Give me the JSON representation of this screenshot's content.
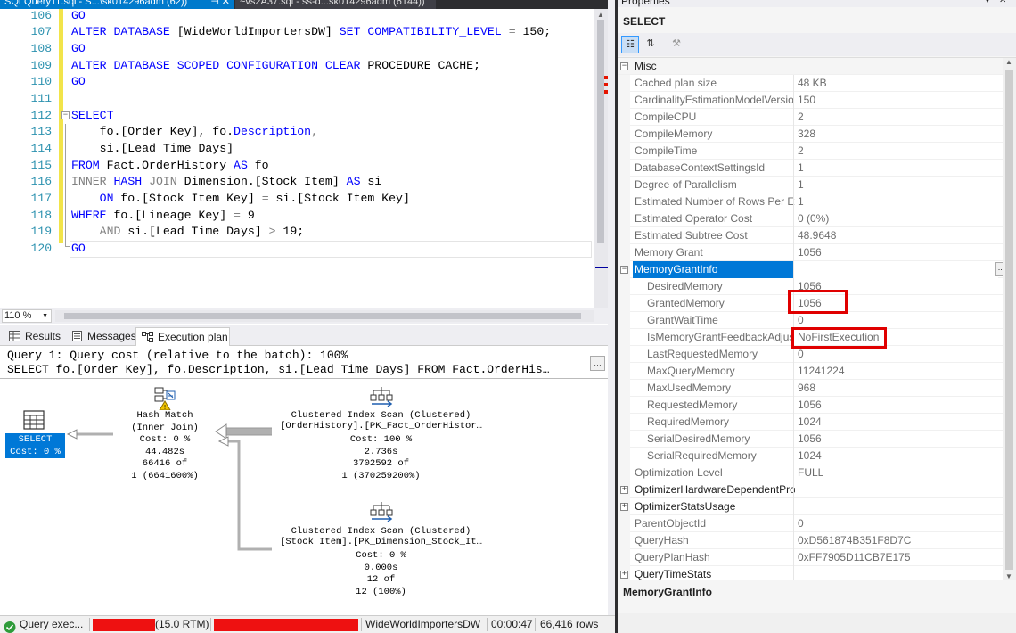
{
  "doc_tabs": {
    "active_label": "SQLQuery11.sql - S...\\sk014296adm (62))",
    "inactive_label": "~vs2A37.sql - ss-d...sk014296adm (6144))",
    "pin_glyph": "⊣",
    "close_glyph": "✕"
  },
  "editor": {
    "line_numbers": [
      "106",
      "107",
      "108",
      "109",
      "110",
      "111",
      "112",
      "113",
      "114",
      "115",
      "116",
      "117",
      "118",
      "119",
      "120"
    ],
    "code": {
      "l106": {
        "a": "GO"
      },
      "l107": {
        "a": "ALTER DATABASE ",
        "b": "[WideWorldImportersDW]",
        "c": " SET COMPATIBILITY_LEVEL ",
        "d": "=",
        "e": " 150;"
      },
      "l108": {
        "a": "GO"
      },
      "l109": {
        "a": "ALTER DATABASE SCOPED CONFIGURATION CLEAR",
        "b": " PROCEDURE_CACHE;"
      },
      "l110": {
        "a": "GO"
      },
      "l112": {
        "a": "SELECT"
      },
      "l113": {
        "a": "    fo.[Order Key], fo.",
        "b": "Description",
        "c": ","
      },
      "l114": {
        "a": "    si.[Lead Time Days]"
      },
      "l115": {
        "a": "FROM",
        "b": " Fact.OrderHistory ",
        "c": "AS",
        "d": " fo"
      },
      "l116": {
        "a": "INNER",
        "b": " HASH ",
        "c": "JOIN",
        "d": " Dimension.[Stock Item] ",
        "e": "AS",
        "f": " si"
      },
      "l117": {
        "a": "    ",
        "b": "ON",
        "c": " fo.[Stock Item Key] ",
        "d": "=",
        "e": " si.[Stock Item Key]"
      },
      "l118": {
        "a": "WHERE",
        "b": " fo.[Lineage Key] ",
        "c": "=",
        "d": " 9"
      },
      "l119": {
        "a": "    ",
        "b": "AND",
        "c": " si.[Lead Time Days] ",
        "d": ">",
        "e": " 19;"
      },
      "l120": {
        "a": "GO"
      }
    },
    "outline_collapse_glyph": "−"
  },
  "zoom": {
    "value": "110 %",
    "dropdown_glyph": "▼"
  },
  "result_tabs": [
    {
      "label": "Results"
    },
    {
      "label": "Messages"
    },
    {
      "label": "Execution plan"
    }
  ],
  "plan": {
    "header_line1": "Query 1: Query cost (relative to the batch): 100%",
    "header_line2": "SELECT fo.[Order Key], fo.Description, si.[Lead Time Days] FROM Fact.OrderHis…",
    "expand_glyph": "…",
    "select_node": {
      "line1": "SELECT",
      "line2": "Cost: 0 %"
    },
    "hash_match": {
      "line1": "Hash Match",
      "line2": "(Inner Join)",
      "line3": "Cost: 0 %",
      "line4": "44.482s",
      "line5": "66416 of",
      "line6": "1 (6641600%)"
    },
    "scan_order": {
      "line1": "Clustered Index Scan (Clustered)",
      "line2": "[OrderHistory].[PK_Fact_OrderHistor…",
      "line3": "Cost: 100 %",
      "line4": "2.736s",
      "line5": "3702592 of",
      "line6": "1 (370259200%)"
    },
    "scan_stock": {
      "line1": "Clustered Index Scan (Clustered)",
      "line2": "[Stock Item].[PK_Dimension_Stock_It…",
      "line3": "Cost: 0 %",
      "line4": "0.000s",
      "line5": "12 of",
      "line6": "12 (100%)"
    }
  },
  "properties": {
    "title": "Properties",
    "pin_glyph": "▼",
    "close_glyph": "✕",
    "object_name": "SELECT",
    "toolbar": {
      "categorized_glyph": "☷",
      "alpha_glyph": "⇅",
      "pages_glyph": "⚒"
    },
    "ellipsis_glyph": "...",
    "collapse_glyph": "−",
    "expand_glyph": "+",
    "rows": [
      {
        "name": "Misc",
        "value": ""
      },
      {
        "name": "Cached plan size",
        "value": "48 KB"
      },
      {
        "name": "CardinalityEstimationModelVersio",
        "value": "150"
      },
      {
        "name": "CompileCPU",
        "value": "2"
      },
      {
        "name": "CompileMemory",
        "value": "328"
      },
      {
        "name": "CompileTime",
        "value": "2"
      },
      {
        "name": "DatabaseContextSettingsId",
        "value": "1"
      },
      {
        "name": "Degree of Parallelism",
        "value": "1"
      },
      {
        "name": "Estimated Number of Rows Per Ex",
        "value": "1"
      },
      {
        "name": "Estimated Operator Cost",
        "value": "0 (0%)"
      },
      {
        "name": "Estimated Subtree Cost",
        "value": "48.9648"
      },
      {
        "name": "Memory Grant",
        "value": "1056"
      },
      {
        "name": "MemoryGrantInfo",
        "value": ""
      },
      {
        "name": "DesiredMemory",
        "value": "1056"
      },
      {
        "name": "GrantedMemory",
        "value": "1056"
      },
      {
        "name": "GrantWaitTime",
        "value": "0"
      },
      {
        "name": "IsMemoryGrantFeedbackAdjus",
        "value": "NoFirstExecution"
      },
      {
        "name": "LastRequestedMemory",
        "value": "0"
      },
      {
        "name": "MaxQueryMemory",
        "value": "11241224"
      },
      {
        "name": "MaxUsedMemory",
        "value": "968"
      },
      {
        "name": "RequestedMemory",
        "value": "1056"
      },
      {
        "name": "RequiredMemory",
        "value": "1024"
      },
      {
        "name": "SerialDesiredMemory",
        "value": "1056"
      },
      {
        "name": "SerialRequiredMemory",
        "value": "1024"
      },
      {
        "name": "Optimization Level",
        "value": "FULL"
      },
      {
        "name": "OptimizerHardwareDependentPro",
        "value": ""
      },
      {
        "name": "OptimizerStatsUsage",
        "value": ""
      },
      {
        "name": "ParentObjectId",
        "value": "0"
      },
      {
        "name": "QueryHash",
        "value": "0xD561874B351F8D7C"
      },
      {
        "name": "QueryPlanHash",
        "value": "0xFF7905D11CB7E175"
      },
      {
        "name": "QueryTimeStats",
        "value": ""
      }
    ],
    "description_title": "MemoryGrantInfo"
  },
  "statusbar": {
    "status_icon_glyph": "✓",
    "status_text": "Query exec...",
    "server_version": "(15.0 RTM)",
    "database": "WideWorldImportersDW",
    "elapsed": "00:00:47",
    "rows": "66,416 rows"
  },
  "colors": {
    "keyword": "#0000ff",
    "function": "#ff00ff",
    "operator": "#808080",
    "line_number": "#2b91af",
    "selection": "#0078d7",
    "highlight_box": "#e00000",
    "redaction": "#ee1111",
    "tab_active": "#007acc"
  }
}
